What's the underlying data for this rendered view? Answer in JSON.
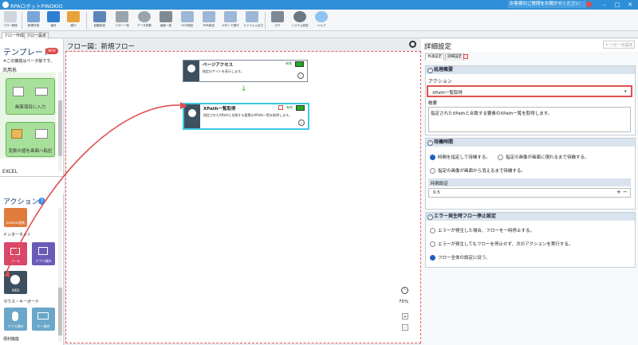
{
  "titlebar": {
    "app_title": "RPAロボットPINOKIO",
    "inquiry_placeholder": "お客様のご質問をお聞かせください"
  },
  "toolbar": {
    "items": [
      "フロー削除",
      "新規作成",
      "保存",
      "実行",
      "起動設定",
      "フロー一覧",
      "データ変数",
      "画面一覧",
      "OCR設定",
      "RPA設定",
      "ボタンで実行",
      "ファイル入出力",
      "ログ",
      "システム設定",
      "ヘルプ"
    ]
  },
  "tabs": [
    "フロー作成",
    "フロー設定"
  ],
  "left": {
    "template_title": "テンプレート",
    "template_badge": "NEW",
    "template_note": "※この機能はベータ版です。",
    "cat_general": "汎用系",
    "tile1_label": "画面項目に入力",
    "tile2_label": "変数の値を画面へ転記",
    "cat_excel": "EXCEL",
    "action_title": "アクション",
    "action_help": "?",
    "act_kintone": "kintone連携",
    "cat_internet": "インターネット",
    "act_mail": "メール",
    "act_app": "アプリ操作",
    "act_web": "WEB",
    "cat_mouse": "マウス・キーボード",
    "act_mouse": "マウス操作",
    "act_key": "キー操作",
    "cat_util": "便利機能"
  },
  "flow": {
    "header": "フロー図：新規フロー",
    "zoom_label": "75%",
    "node1": {
      "title": "ページアクセス",
      "desc": "指定のサイトを表示します。",
      "badge": "有効",
      "icon_label": "WEB"
    },
    "node2": {
      "title": "XPath一覧取得",
      "desc": "指定されたXPathと合致する要素のXPath一覧を取得します。",
      "badge": "有効",
      "icon_label": "WEB"
    }
  },
  "detail": {
    "header": "詳細設定",
    "trigger_button": "トリガーの設定",
    "tabs": [
      "共通設定",
      "詳細設定"
    ],
    "sec_process": "処理概要",
    "action_label": "アクション",
    "action_value": "XPath一覧取得",
    "summary_label": "概要",
    "summary_text": "指定されたXPathと合致する要素のXPath一覧を取得します。",
    "sec_wait": "待機時間",
    "wait_opt1": "時間を指定して待機する。",
    "wait_opt2": "指定の画像が画面に現れるまで待機する。",
    "wait_opt3": "指定の画像が画面から消えるまで待機する。",
    "time_label": "時間設定",
    "time_value": "0.5",
    "sec_error": "エラー発生時フロー停止設定",
    "err_opt1": "エラーが発生した場合、フローを一時停止する。",
    "err_opt2": "エラーが発生してもフローを停止せず、次のアクションを実行する。",
    "err_opt3": "フロー全体の設定に従う。"
  }
}
